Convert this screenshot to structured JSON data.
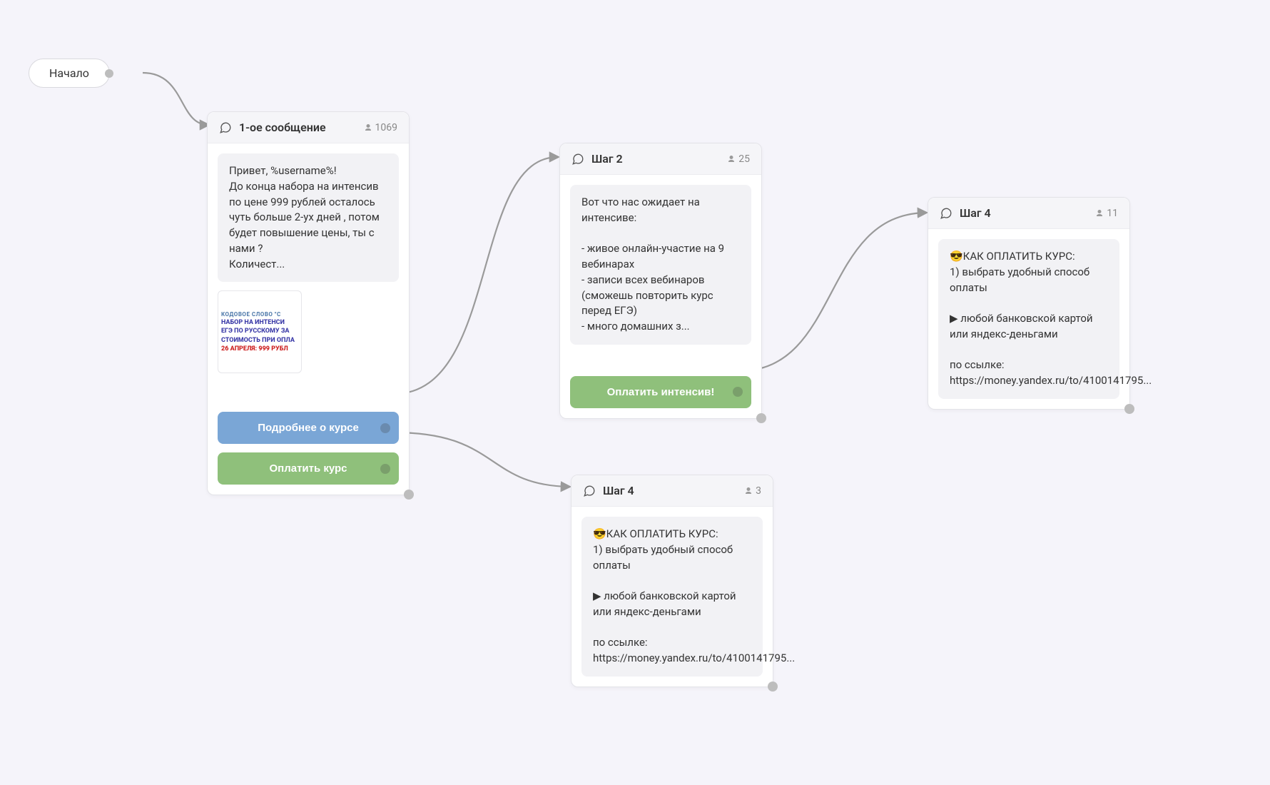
{
  "start": {
    "label": "Начало"
  },
  "nodes": {
    "n1": {
      "title": "1-ое сообщение",
      "count": "1069",
      "message": "Привет, %username%!\nДо конца набора на интенсив по цене 999 рублей осталось чуть больше 2-ух дней , потом будет повышение цены, ты с нами ?\nКоличест...",
      "thumb": {
        "line1": "КОДОВОЕ СЛОВО \"С",
        "line2": "НАБОР НА ИНТЕНСИ",
        "line3": "ЕГЭ ПО РУССКОМУ ЗА",
        "line4": "СТОИМОСТЬ ПРИ ОПЛА",
        "line5": "26 АПРЕЛЯ: 999 РУБЛ"
      },
      "buttons": [
        {
          "label": "Подробнее о курсе",
          "color": "blue"
        },
        {
          "label": "Оплатить курс",
          "color": "green"
        }
      ]
    },
    "n2": {
      "title": "Шаг 2",
      "count": "25",
      "message": "Вот что нас ожидает на интенсиве:\n\n- живое онлайн-участие на 9 вебинарах\n- записи всех вебинаров (сможешь повторить курс перед ЕГЭ)\n- много домашних з...",
      "buttons": [
        {
          "label": "Оплатить интенсив!",
          "color": "green"
        }
      ]
    },
    "n3": {
      "title": "Шаг 4",
      "count": "11",
      "message": "😎КАК ОПЛАТИТЬ КУРС:\n1) выбрать удобный способ оплаты\n\n▶ любой банковской картой или яндекс-деньгами\n\nпо ссылке: https://money.yandex.ru/to/4100141795..."
    },
    "n4": {
      "title": "Шаг 4",
      "count": "3",
      "message": "😎КАК ОПЛАТИТЬ КУРС:\n1) выбрать удобный способ оплаты\n\n▶ любой банковской картой или яндекс-деньгами\n\nпо ссылке: https://money.yandex.ru/to/4100141795..."
    }
  }
}
